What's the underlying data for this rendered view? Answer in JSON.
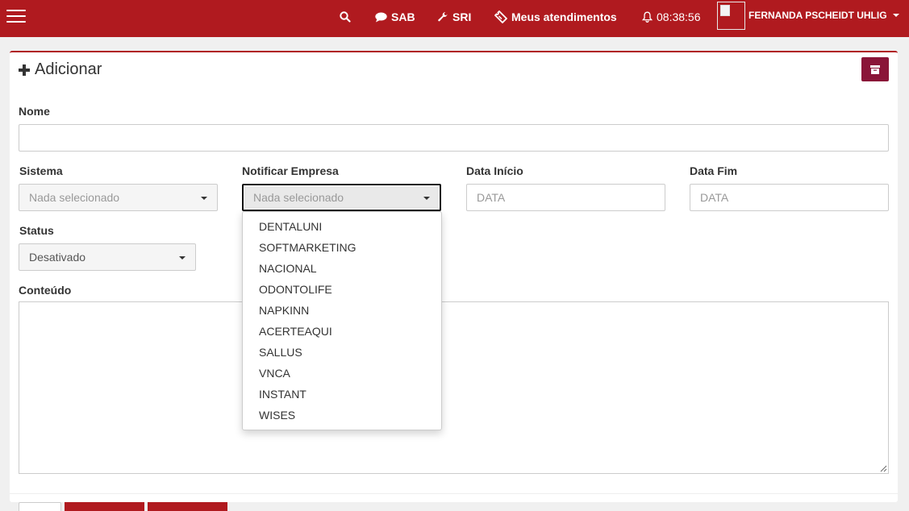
{
  "navbar": {
    "sab": "SAB",
    "sri": "SRI",
    "atendimentos": "Meus atendimentos",
    "clock": "08:38:56",
    "user": "FERNANDA PSCHEIDT UHLIG",
    "bg_color": "#b01a1f"
  },
  "panel": {
    "title": "Adicionar"
  },
  "form": {
    "nome_label": "Nome",
    "sistema_label": "Sistema",
    "sistema_value": "Nada selecionado",
    "notificar_label": "Notificar Empresa",
    "notificar_value": "Nada selecionado",
    "data_inicio_label": "Data Início",
    "data_inicio_placeholder": "DATA",
    "data_fim_label": "Data Fim",
    "data_fim_placeholder": "DATA",
    "status_label": "Status",
    "status_value": "Desativado",
    "conteudo_label": "Conteúdo"
  },
  "dropdown": {
    "options": [
      "DENTALUNI",
      "SOFTMARKETING",
      "NACIONAL",
      "ODONTOLIFE",
      "NAPKINN",
      "ACERTEAQUI",
      "SALLUS",
      "VNCA",
      "INSTANT",
      "WISES"
    ]
  },
  "icons": {
    "menu": "hamburger-icon",
    "search": "search-icon",
    "sab": "comment-icon",
    "sri": "wrench-icon",
    "atendimentos": "ticket-icon",
    "clock": "bell-icon",
    "archive": "archive-icon"
  }
}
